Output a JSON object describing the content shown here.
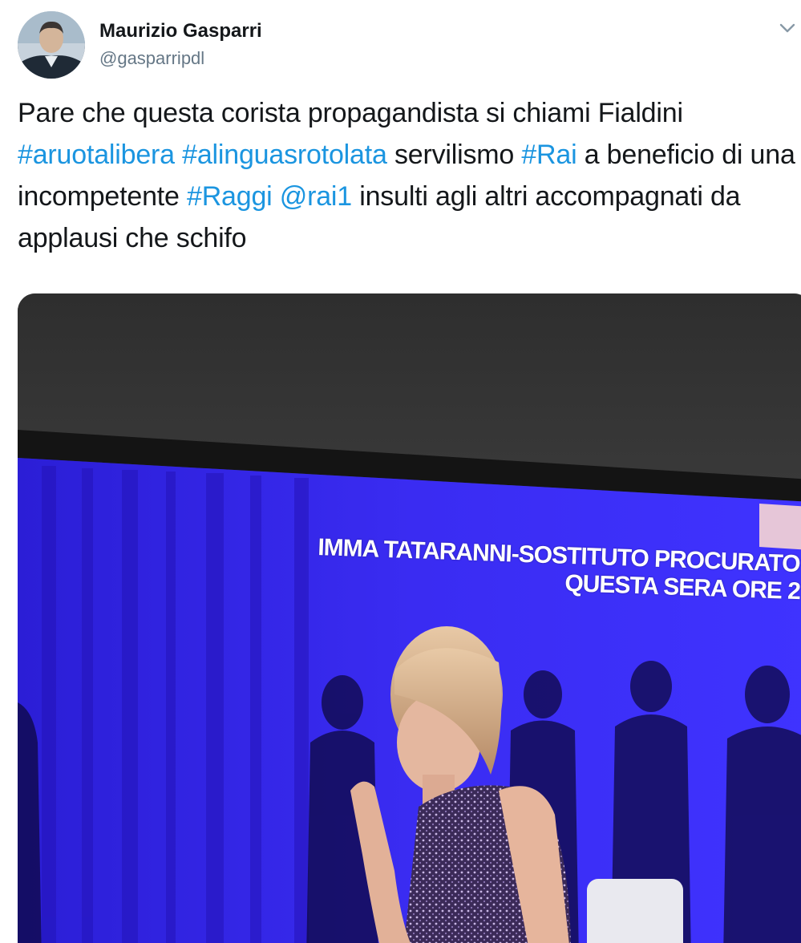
{
  "author": {
    "name": "Maurizio Gasparri",
    "handle": "@gasparripdl",
    "avatar_icon": "profile-photo"
  },
  "menu": {
    "icon": "chevron-down-icon"
  },
  "tweet": {
    "segments": [
      {
        "text": "Pare che questa corista propagandista si chiami Fialdini ",
        "type": "text"
      },
      {
        "text": "#aruotalibera",
        "type": "link"
      },
      {
        "text": " ",
        "type": "text"
      },
      {
        "text": "#alinguasrotolata",
        "type": "link"
      },
      {
        "text": " servilismo ",
        "type": "text"
      },
      {
        "text": "#Rai",
        "type": "link"
      },
      {
        "text": " a beneficio di una incompetente ",
        "type": "text"
      },
      {
        "text": "#Raggi",
        "type": "link"
      },
      {
        "text": " ",
        "type": "text"
      },
      {
        "text": "@rai1",
        "type": "link"
      },
      {
        "text": " insulti agli altri accompagnati da applausi che schifo",
        "type": "text"
      }
    ]
  },
  "media": {
    "caption_line1": "IMMA TATARANNI-SOSTITUTO PROCURATO",
    "caption_line2": "QUESTA SERA ORE 2"
  },
  "colors": {
    "link": "#1b95e0",
    "text": "#14171a",
    "secondary": "#657786"
  }
}
